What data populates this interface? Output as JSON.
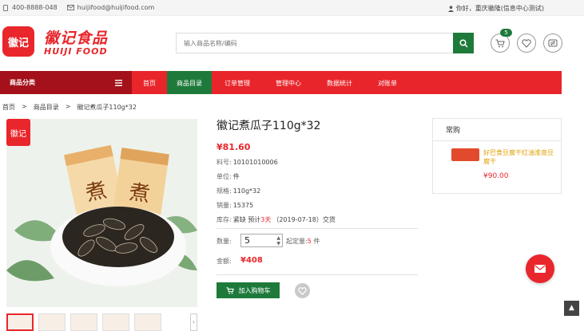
{
  "topbar": {
    "phone": "400-8888-048",
    "email": "huijifood@huijifood.com",
    "greeting": "你好，重庆徽隆(信息中心测试)"
  },
  "brand": {
    "logo_text": "徽记",
    "name_cn": "徽记食品",
    "name_en": "HUIJI FOOD"
  },
  "search": {
    "placeholder": "输入商品名称/编码"
  },
  "header": {
    "cart_count": "5"
  },
  "nav": {
    "category_label": "商品分类",
    "items": [
      "首页",
      "商品目录",
      "订单管理",
      "管理中心",
      "数据统计",
      "对账单"
    ]
  },
  "breadcrumb": [
    "首页",
    "商品目录",
    "徽记煮瓜子110g*32"
  ],
  "product": {
    "title": "徽记煮瓜子110g*32",
    "price": "¥81.60",
    "sku_label": "料号:",
    "sku": "10101010006",
    "unit_label": "单位:",
    "unit": "件",
    "spec_label": "规格:",
    "spec": "110g*32",
    "sales_label": "销量:",
    "sales": "15375",
    "stock_label": "库存:",
    "stock_text": "紧缺 预计",
    "stock_days": "3天",
    "stock_date": "（2019-07-18）交货",
    "qty_label": "数量:",
    "qty": "5",
    "min_order_label": "起定量:",
    "min_order": "5",
    "min_order_unit": "件",
    "total_label": "金额:",
    "total": "¥408",
    "add_to_cart": "加入购物车",
    "image_logo": "徽记",
    "package_text": "煮"
  },
  "sidebar": {
    "heading": "常购",
    "item_name": "好巴食豆腐干红油淮南豆腐干",
    "item_price": "¥90.00"
  },
  "colors": {
    "brand_red": "#e8262b",
    "nav_dark": "#a4111a",
    "green": "#1e7a3b"
  }
}
